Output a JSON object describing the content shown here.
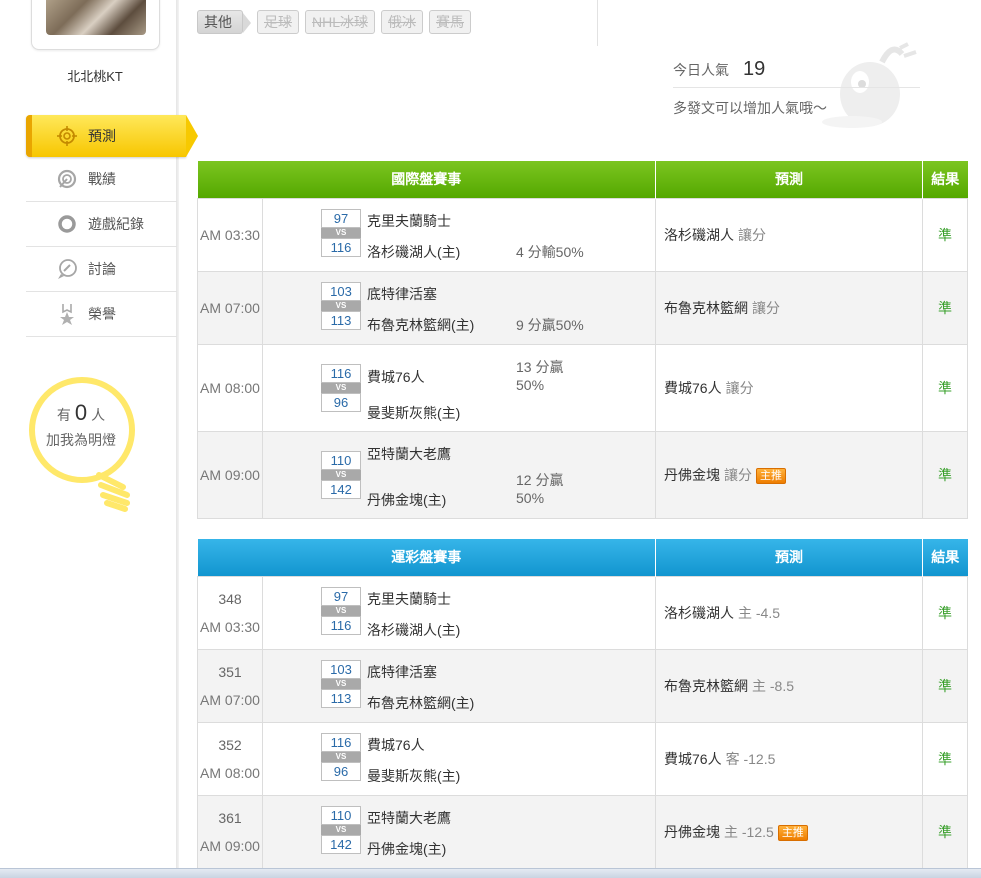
{
  "user": {
    "name": "北北桃KT"
  },
  "nav": [
    {
      "label": "預測",
      "icon": "target-icon",
      "active": true
    },
    {
      "label": "戰績",
      "icon": "speedometer-icon"
    },
    {
      "label": "遊戲紀錄",
      "icon": "ring-icon"
    },
    {
      "label": "討論",
      "icon": "chat-bubble-icon"
    },
    {
      "label": "榮譽",
      "icon": "medal-icon"
    }
  ],
  "fans": {
    "prefix": "有",
    "count": "0",
    "suffix": "人",
    "caption": "加我為明燈"
  },
  "tags": [
    "其他",
    "足球",
    "NHL冰球",
    "俄冰",
    "賽馬"
  ],
  "popularity": {
    "label": "今日人氣",
    "value": "19",
    "hint": "多發文可以增加人氣哦～"
  },
  "intl_table": {
    "headers": [
      "國際盤賽事",
      "預測",
      "結果"
    ],
    "rows": [
      {
        "time": "AM 03:30",
        "away_score": "97",
        "home_score": "116",
        "away": "克里夫蘭騎士",
        "home": "洛杉磯湖人(主)",
        "line": "4 分輸50%",
        "pick": "洛杉磯湖人",
        "pick_type": "讓分",
        "badge": "",
        "result": "準"
      },
      {
        "time": "AM 07:00",
        "away_score": "103",
        "home_score": "113",
        "away": "底特律活塞",
        "home": "布魯克林籃網(主)",
        "line": "9 分贏50%",
        "pick": "布魯克林籃網",
        "pick_type": "讓分",
        "badge": "",
        "result": "準"
      },
      {
        "time": "AM 08:00",
        "away_score": "116",
        "home_score": "96",
        "away": "費城76人",
        "home": "曼斐斯灰熊(主)",
        "line_a": "13 分贏",
        "line_b": "50%",
        "pick": "費城76人",
        "pick_type": "讓分",
        "badge": "",
        "result": "準"
      },
      {
        "time": "AM 09:00",
        "away_score": "110",
        "home_score": "142",
        "away": "亞特蘭大老鷹",
        "home": "丹佛金塊(主)",
        "line_a": "12 分贏",
        "line_b": "50%",
        "pick": "丹佛金塊",
        "pick_type": "讓分",
        "badge": "主推",
        "result": "準"
      }
    ]
  },
  "sport_table": {
    "headers": [
      "運彩盤賽事",
      "預測",
      "結果"
    ],
    "rows": [
      {
        "gid": "348",
        "time": "AM 03:30",
        "away_score": "97",
        "home_score": "116",
        "away": "克里夫蘭騎士",
        "home": "洛杉磯湖人(主)",
        "pick": "洛杉磯湖人",
        "pick_type": "主 -4.5",
        "badge": "",
        "result": "準"
      },
      {
        "gid": "351",
        "time": "AM 07:00",
        "away_score": "103",
        "home_score": "113",
        "away": "底特律活塞",
        "home": "布魯克林籃網(主)",
        "pick": "布魯克林籃網",
        "pick_type": "主 -8.5",
        "badge": "",
        "result": "準"
      },
      {
        "gid": "352",
        "time": "AM 08:00",
        "away_score": "116",
        "home_score": "96",
        "away": "費城76人",
        "home": "曼斐斯灰熊(主)",
        "pick": "費城76人",
        "pick_type": "客 -12.5",
        "badge": "",
        "result": "準"
      },
      {
        "gid": "361",
        "time": "AM 09:00",
        "away_score": "110",
        "home_score": "142",
        "away": "亞特蘭大老鷹",
        "home": "丹佛金塊(主)",
        "pick": "丹佛金塊",
        "pick_type": "主 -12.5",
        "badge": "主推",
        "result": "準"
      }
    ]
  },
  "vs_label": "VS",
  "colors": {
    "green_header": "#5aac00",
    "blue_header": "#1a9bd4",
    "accent_yellow": "#f7c600",
    "win_green": "#3aa02c"
  }
}
